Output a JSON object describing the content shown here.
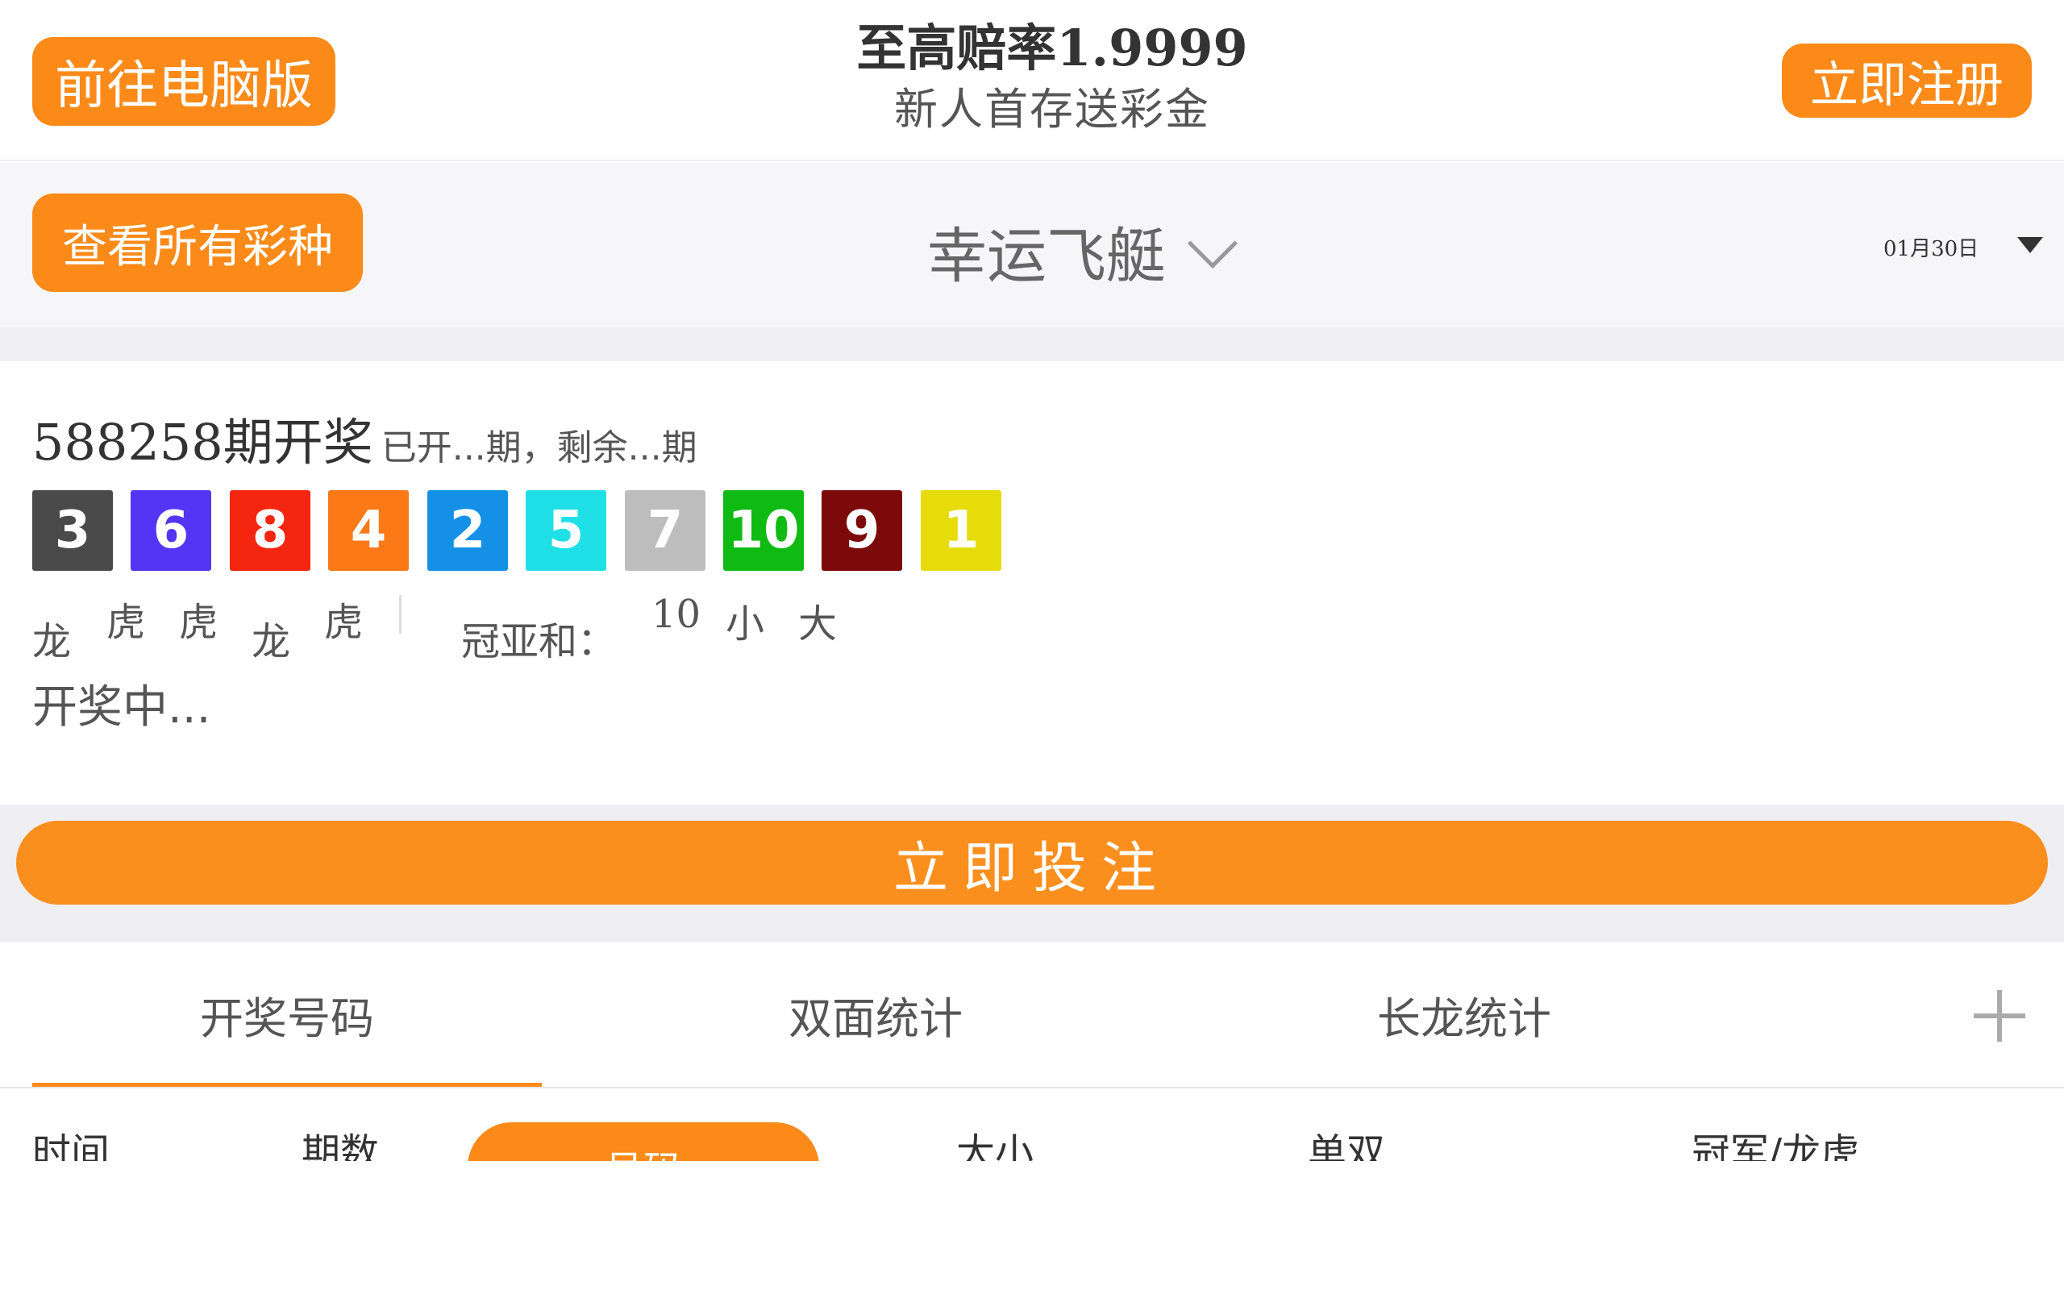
{
  "topbar": {
    "pc_button": "前往电脑版",
    "promo_title": "至高赔率1.9999",
    "promo_subtitle": "新人首存送彩金",
    "register_button": "立即注册"
  },
  "selector": {
    "all_games_button": "查看所有彩种",
    "game_name": "幸运飞艇",
    "date": "01月30日"
  },
  "result": {
    "issue_number": "588258",
    "issue_suffix": "期开奖",
    "issue_info": "已开...期，剩余...期",
    "balls": [
      {
        "num": "3",
        "color": "#4a4a4a"
      },
      {
        "num": "6",
        "color": "#5535f5"
      },
      {
        "num": "8",
        "color": "#f5260f"
      },
      {
        "num": "4",
        "color": "#fb7a17"
      },
      {
        "num": "2",
        "color": "#1491e6"
      },
      {
        "num": "5",
        "color": "#1fe0e6"
      },
      {
        "num": "7",
        "color": "#bdbdbd"
      },
      {
        "num": "10",
        "color": "#0fba13"
      },
      {
        "num": "9",
        "color": "#7d0a0a"
      },
      {
        "num": "1",
        "color": "#e6dc0a"
      }
    ],
    "dragon_tiger": [
      "龙",
      "虎",
      "虎",
      "龙",
      "虎"
    ],
    "sum_label": "冠亚和：",
    "sum_values": [
      "10",
      "小",
      "大"
    ],
    "status": "开奖中..."
  },
  "bet_button": "立即投注",
  "tabs": [
    "开奖号码",
    "双面统计",
    "长龙统计"
  ],
  "table_headers": [
    "时间",
    "期数",
    "号码",
    "大小",
    "单双",
    "冠军/龙虎"
  ],
  "colors": {
    "accent": "#fb8a19"
  }
}
